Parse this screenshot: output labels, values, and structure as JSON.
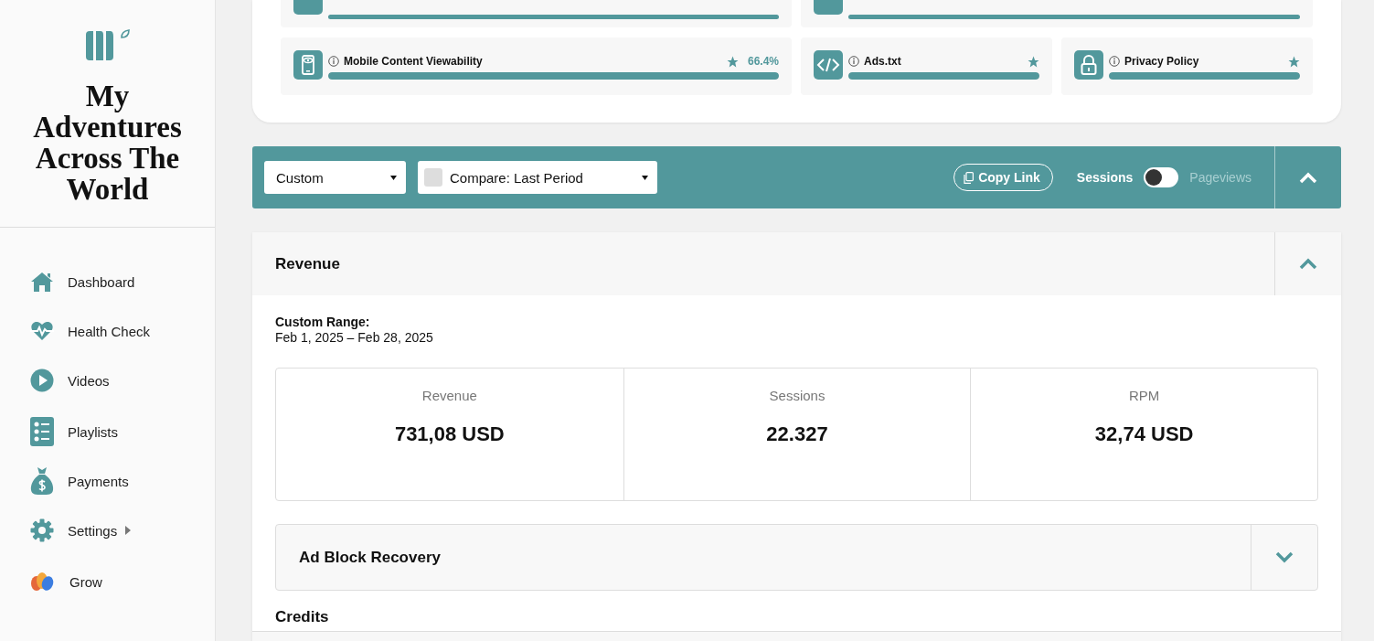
{
  "site": {
    "title": "My Adventures Across The World"
  },
  "nav": [
    {
      "label": "Dashboard",
      "has_submenu": false
    },
    {
      "label": "Health Check",
      "has_submenu": false
    },
    {
      "label": "Videos",
      "has_submenu": false
    },
    {
      "label": "Playlists",
      "has_submenu": false
    },
    {
      "label": "Payments",
      "has_submenu": false
    },
    {
      "label": "Settings",
      "has_submenu": true
    },
    {
      "label": "Grow",
      "has_submenu": false
    }
  ],
  "health_checks": [
    {
      "label": "Mobile Content Viewability",
      "starred": true,
      "score": "66.4%",
      "level": 1
    },
    {
      "label": "Ads.txt",
      "starred": true,
      "level": 1
    },
    {
      "label": "Privacy Policy",
      "starred": true,
      "level": 1
    }
  ],
  "toolbar": {
    "range": "Custom",
    "compare": "Compare: Last Period",
    "compare_checked": false,
    "copy_link": "Copy Link",
    "toggle_left": "Sessions",
    "toggle_right": "Pageviews",
    "toggle_on": false,
    "expanded": true
  },
  "revenue": {
    "title": "Revenue",
    "expanded": true,
    "range_label": "Custom Range:",
    "range": "Feb 1, 2025 – Feb 28, 2025",
    "stats": [
      {
        "label": "Revenue",
        "value": "731,08 USD"
      },
      {
        "label": "Sessions",
        "value": "22.327"
      },
      {
        "label": "RPM",
        "value": "32,74 USD"
      }
    ],
    "sections": [
      {
        "title": "Ad Block Recovery",
        "expanded": false
      }
    ],
    "credits": "Credits"
  }
}
